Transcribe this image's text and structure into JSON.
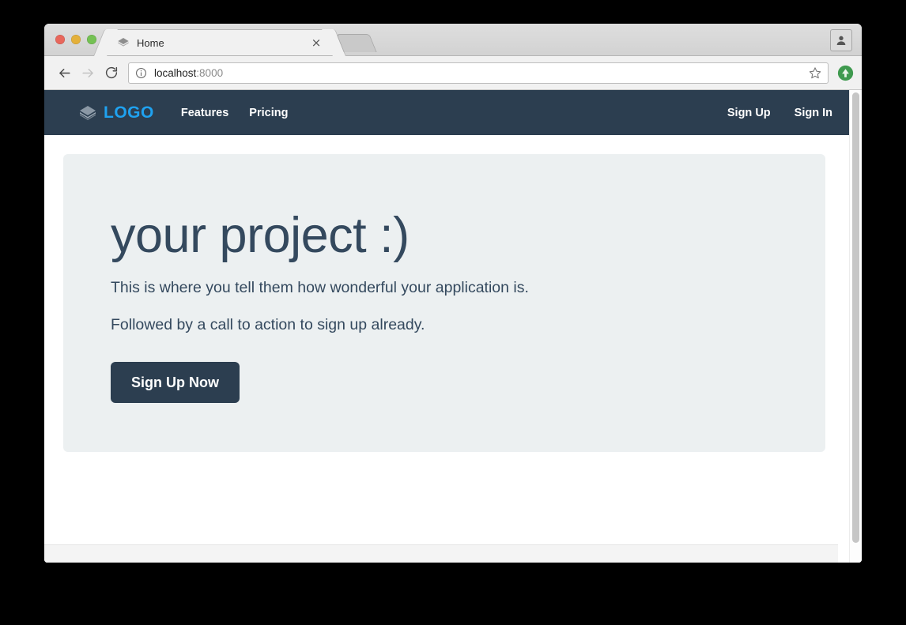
{
  "browser": {
    "window_controls": [
      {
        "name": "close",
        "color": "#e8675c"
      },
      {
        "name": "minimize",
        "color": "#e4b03a"
      },
      {
        "name": "zoom",
        "color": "#74c153"
      }
    ],
    "tab": {
      "title": "Home",
      "favicon": "layers-icon",
      "close_label": "×"
    },
    "new_tab_label": "",
    "profile_icon": "person-icon",
    "toolbar": {
      "back_icon": "back-arrow-icon",
      "forward_icon": "forward-arrow-icon",
      "reload_icon": "reload-icon",
      "url_info_icon": "info-circle-icon",
      "url_host": "localhost",
      "url_port": ":8000",
      "url_full": "localhost:8000",
      "bookmark_icon": "star-icon",
      "extension_icon": "green-up-arrow-icon"
    }
  },
  "site": {
    "navbar": {
      "brand": {
        "icon": "layers-icon",
        "text": "LOGO",
        "color": "#1fa2f0"
      },
      "left_links": [
        {
          "label": "Features"
        },
        {
          "label": "Pricing"
        }
      ],
      "right_links": [
        {
          "label": "Sign Up"
        },
        {
          "label": "Sign In"
        }
      ],
      "background": "#2c3e50"
    },
    "hero": {
      "title": "your project :)",
      "paragraphs": [
        "This is where you tell them how wonderful your application is.",
        "Followed by a call to action to sign up already."
      ],
      "cta_label": "Sign Up Now",
      "background": "#ecf0f1",
      "text_color": "#34495e",
      "cta_background": "#2c3e50"
    }
  }
}
